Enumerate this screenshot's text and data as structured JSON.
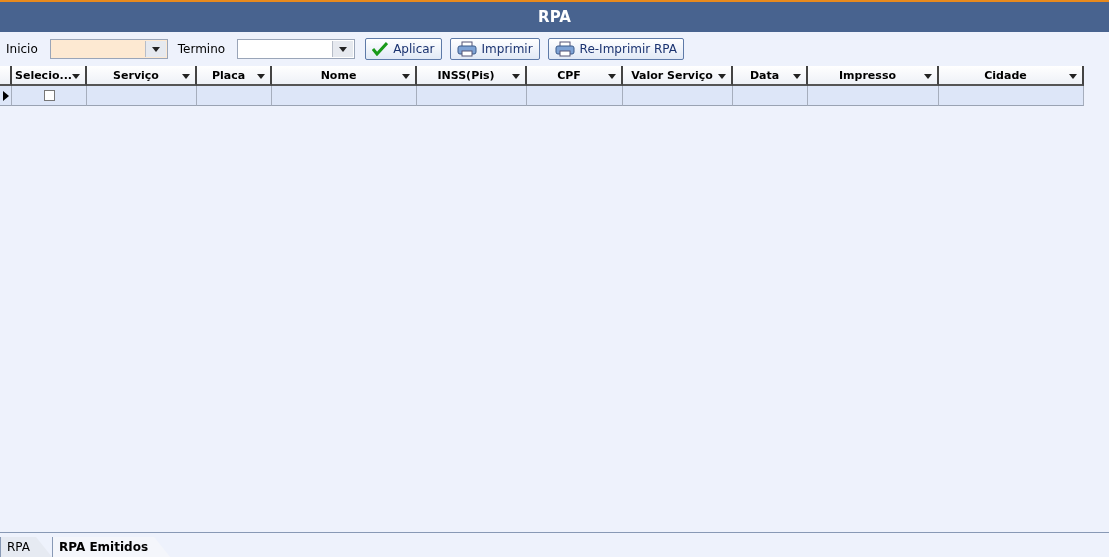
{
  "window": {
    "title": "RPA"
  },
  "filters": [
    {
      "label": "Inicio",
      "focused": true
    },
    {
      "label": "Termino",
      "focused": false
    }
  ],
  "buttons": [
    {
      "label": "Aplicar",
      "kind": "apply"
    },
    {
      "label": "Imprimir",
      "kind": "print"
    },
    {
      "label": "Re-Imprimir RPA",
      "kind": "print"
    }
  ],
  "table": {
    "columns": [
      "Selecio...",
      "Serviço",
      "Placa",
      "Nome",
      "INSS(Pis)",
      "CPF",
      "Valor Serviço",
      "Data",
      "Impresso",
      "Cidade"
    ],
    "rows": [
      {
        "selected": true,
        "checked": false
      }
    ]
  },
  "tabs": [
    {
      "label": "RPA",
      "selected": false
    },
    {
      "label": "RPA Emitidos",
      "selected": true
    }
  ]
}
